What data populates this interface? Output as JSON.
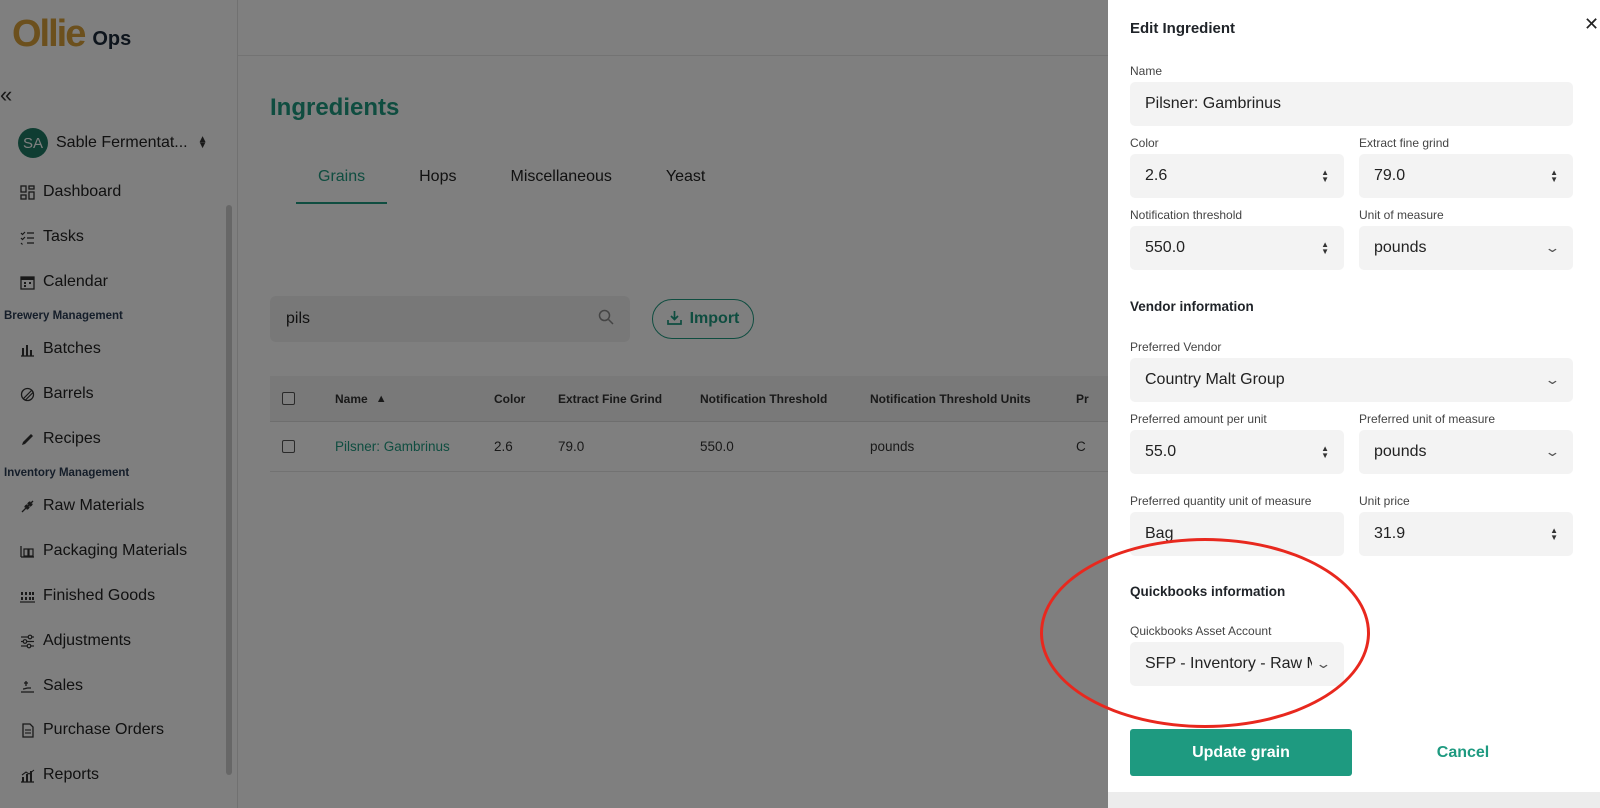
{
  "sidebar": {
    "brand": "Ollie",
    "brand_sub": "Ops",
    "org_initials": "SA",
    "org_name": "Sable Fermentat...",
    "items": [
      {
        "label": "Dashboard",
        "icon": "dashboard-icon"
      },
      {
        "label": "Tasks",
        "icon": "tasks-icon"
      },
      {
        "label": "Calendar",
        "icon": "calendar-icon"
      }
    ],
    "section_brewery": "Brewery Management",
    "brewery_items": [
      {
        "label": "Batches",
        "icon": "batches-icon"
      },
      {
        "label": "Barrels",
        "icon": "barrels-icon"
      },
      {
        "label": "Recipes",
        "icon": "recipes-icon"
      }
    ],
    "section_inventory": "Inventory Management",
    "inventory_items": [
      {
        "label": "Raw Materials",
        "icon": "raw-materials-icon"
      },
      {
        "label": "Packaging Materials",
        "icon": "packaging-icon"
      },
      {
        "label": "Finished Goods",
        "icon": "finished-goods-icon"
      },
      {
        "label": "Adjustments",
        "icon": "adjustments-icon"
      },
      {
        "label": "Sales",
        "icon": "sales-icon"
      },
      {
        "label": "Purchase Orders",
        "icon": "purchase-orders-icon"
      },
      {
        "label": "Reports",
        "icon": "reports-icon"
      }
    ]
  },
  "main": {
    "title": "Ingredients",
    "tabs": [
      {
        "label": "Grains",
        "active": true
      },
      {
        "label": "Hops",
        "active": false
      },
      {
        "label": "Miscellaneous",
        "active": false
      },
      {
        "label": "Yeast",
        "active": false
      }
    ],
    "search_value": "pils",
    "import_label": "Import",
    "table": {
      "columns": [
        "Name",
        "Color",
        "Extract Fine Grind",
        "Notification Threshold",
        "Notification Threshold Units",
        "Pr"
      ],
      "rows": [
        {
          "name": "Pilsner: Gambrinus",
          "color": "2.6",
          "extract": "79.0",
          "threshold": "550.0",
          "units": "pounds",
          "pref": "C"
        }
      ]
    }
  },
  "drawer": {
    "title": "Edit Ingredient",
    "name_label": "Name",
    "name_value": "Pilsner: Gambrinus",
    "color_label": "Color",
    "color_value": "2.6",
    "extract_label": "Extract fine grind",
    "extract_value": "79.0",
    "threshold_label": "Notification threshold",
    "threshold_value": "550.0",
    "uom_label": "Unit of measure",
    "uom_value": "pounds",
    "vendor_section": "Vendor information",
    "vendor_label": "Preferred Vendor",
    "vendor_value": "Country Malt Group",
    "amount_label": "Preferred amount per unit",
    "amount_value": "55.0",
    "pref_uom_label": "Preferred unit of measure",
    "pref_uom_value": "pounds",
    "qty_uom_label": "Preferred quantity unit of measure",
    "qty_uom_value": "Bag",
    "price_label": "Unit price",
    "price_value": "31.9",
    "qb_section": "Quickbooks information",
    "qb_label": "Quickbooks Asset Account",
    "qb_value": "SFP - Inventory - Raw Materials",
    "update_label": "Update grain",
    "cancel_label": "Cancel"
  },
  "colors": {
    "accent": "#1e9a80",
    "brand": "#d9a13a",
    "annotation": "#e8281e"
  }
}
